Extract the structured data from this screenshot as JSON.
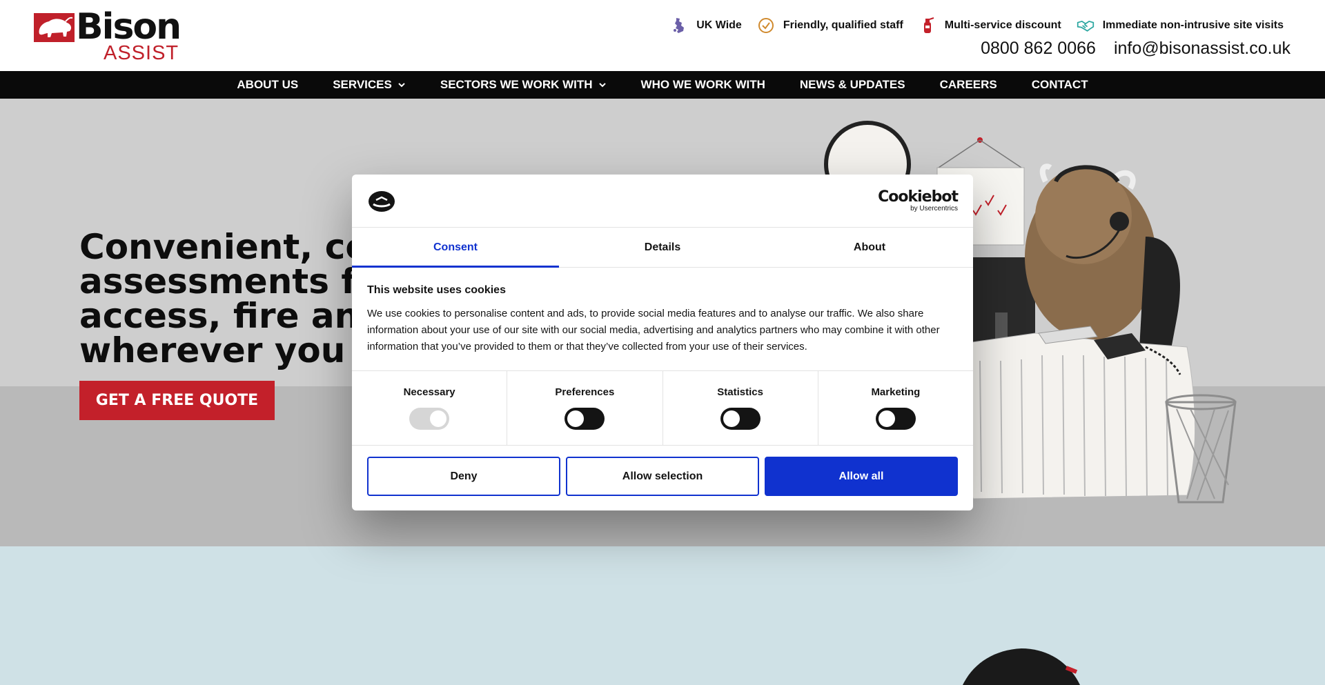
{
  "header": {
    "logo": {
      "word": "Bison",
      "sub": "ASSIST"
    },
    "usps": [
      {
        "icon": "uk-map-icon",
        "label": "UK Wide"
      },
      {
        "icon": "check-circle-icon",
        "label": "Friendly, qualified staff"
      },
      {
        "icon": "fire-extinguisher-icon",
        "label": "Multi-service discount"
      },
      {
        "icon": "handshake-icon",
        "label": "Immediate non-intrusive site visits"
      }
    ],
    "phone": "0800 862 0066",
    "email": "info@bisonassist.co.uk"
  },
  "nav": {
    "items": [
      {
        "label": "ABOUT US",
        "dropdown": false
      },
      {
        "label": "SERVICES",
        "dropdown": true
      },
      {
        "label": "SECTORS WE WORK WITH",
        "dropdown": true
      },
      {
        "label": "WHO WE WORK WITH",
        "dropdown": false
      },
      {
        "label": "NEWS & UPDATES",
        "dropdown": false
      },
      {
        "label": "CAREERS",
        "dropdown": false
      },
      {
        "label": "CONTACT",
        "dropdown": false
      }
    ]
  },
  "hero": {
    "headline_lines": [
      "Convenient, cost",
      "assessments for",
      "access, fire and h",
      "wherever you are"
    ],
    "cta": "GET A FREE QUOTE"
  },
  "cookie_dialog": {
    "brand": "Cookiebot",
    "brand_sub": "by Usercentrics",
    "tabs": [
      {
        "label": "Consent",
        "active": true
      },
      {
        "label": "Details",
        "active": false
      },
      {
        "label": "About",
        "active": false
      }
    ],
    "title": "This website uses cookies",
    "text": "We use cookies to personalise content and ads, to provide social media features and to analyse our traffic. We also share information about your use of our site with our social media, advertising and analytics partners who may combine it with other information that you’ve provided to them or that they’ve collected from your use of their services.",
    "categories": [
      {
        "label": "Necessary",
        "checked": true,
        "disabled": true
      },
      {
        "label": "Preferences",
        "checked": false,
        "disabled": false
      },
      {
        "label": "Statistics",
        "checked": false,
        "disabled": false
      },
      {
        "label": "Marketing",
        "checked": false,
        "disabled": false
      }
    ],
    "buttons": {
      "deny": "Deny",
      "selection": "Allow selection",
      "all": "Allow all"
    }
  },
  "colors": {
    "brand_red": "#c3202a",
    "cookiebot_blue": "#1032cf",
    "nav_bg": "#0a0a0a"
  }
}
